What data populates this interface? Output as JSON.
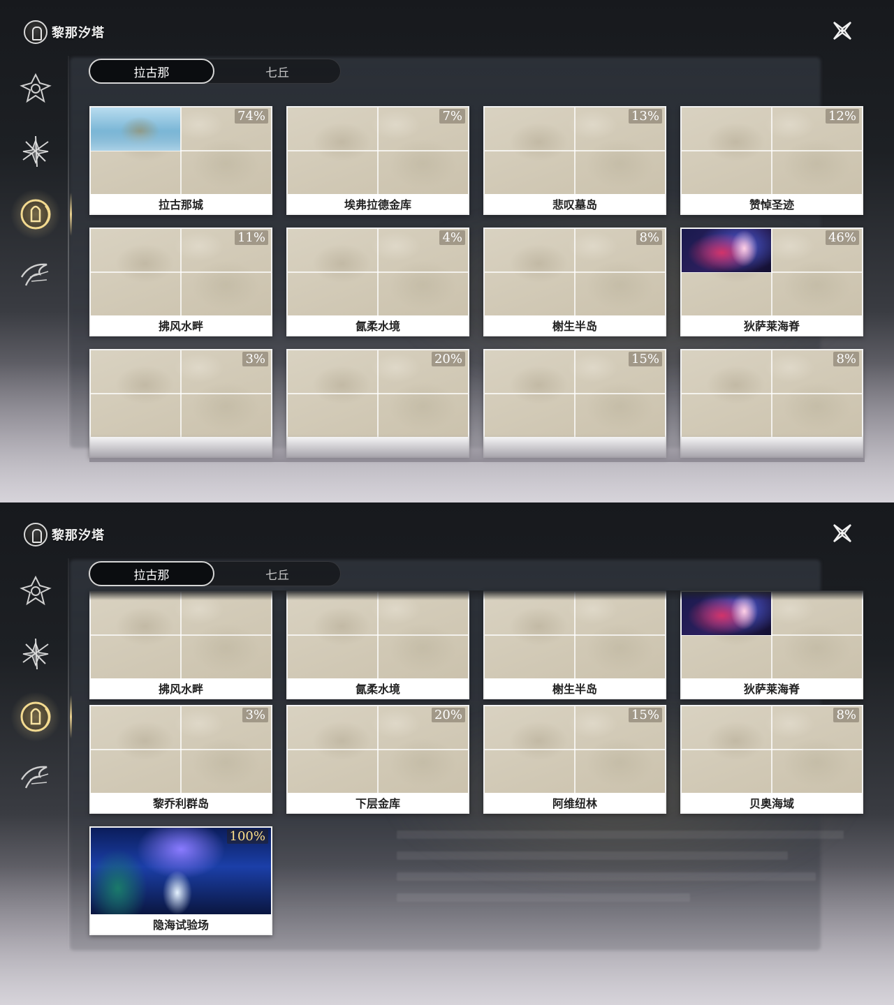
{
  "header": {
    "title": "黎那汐塔",
    "logo_icon": "linnae-emblem-icon",
    "close_icon": "close-x-icon"
  },
  "sidebar": {
    "items": [
      {
        "icon": "crest-emblem-icon",
        "active": false
      },
      {
        "icon": "star-compass-icon",
        "active": false
      },
      {
        "icon": "linnae-medallion-icon",
        "active": true
      },
      {
        "icon": "bird-sigil-icon",
        "active": false
      }
    ]
  },
  "tabs": [
    {
      "label": "拉古那",
      "active": true
    },
    {
      "label": "七丘",
      "active": false
    }
  ],
  "top_view": {
    "cards": [
      {
        "name": "拉古那城",
        "percent": "74%",
        "image": "city"
      },
      {
        "name": "埃弗拉德金库",
        "percent": "7%"
      },
      {
        "name": "悲叹墓岛",
        "percent": "13%"
      },
      {
        "name": "赞悼圣迹",
        "percent": "12%"
      },
      {
        "name": "拂风水畔",
        "percent": "11%"
      },
      {
        "name": "氤柔水境",
        "percent": "4%"
      },
      {
        "name": "榭生半岛",
        "percent": "8%"
      },
      {
        "name": "狄萨莱海脊",
        "percent": "46%",
        "image": "nebula"
      },
      {
        "name": "",
        "percent": "3%"
      },
      {
        "name": "",
        "percent": "20%"
      },
      {
        "name": "",
        "percent": "15%"
      },
      {
        "name": "",
        "percent": "8%"
      }
    ]
  },
  "bottom_view": {
    "cards": [
      {
        "name": "拂风水畔",
        "percent": ""
      },
      {
        "name": "氤柔水境",
        "percent": ""
      },
      {
        "name": "榭生半岛",
        "percent": ""
      },
      {
        "name": "狄萨莱海脊",
        "percent": "",
        "image": "nebula"
      },
      {
        "name": "黎乔利群岛",
        "percent": "3%"
      },
      {
        "name": "下层金库",
        "percent": "20%"
      },
      {
        "name": "阿维纽林",
        "percent": "15%"
      },
      {
        "name": "贝奥海域",
        "percent": "8%"
      },
      {
        "name": "隐海试验场",
        "percent": "100%",
        "image": "ocean",
        "complete": true
      }
    ]
  },
  "colors": {
    "accent_gold": "#e8cf8e",
    "complete_gold": "#ffe08a",
    "map_parchment": "#d3cbb8"
  }
}
